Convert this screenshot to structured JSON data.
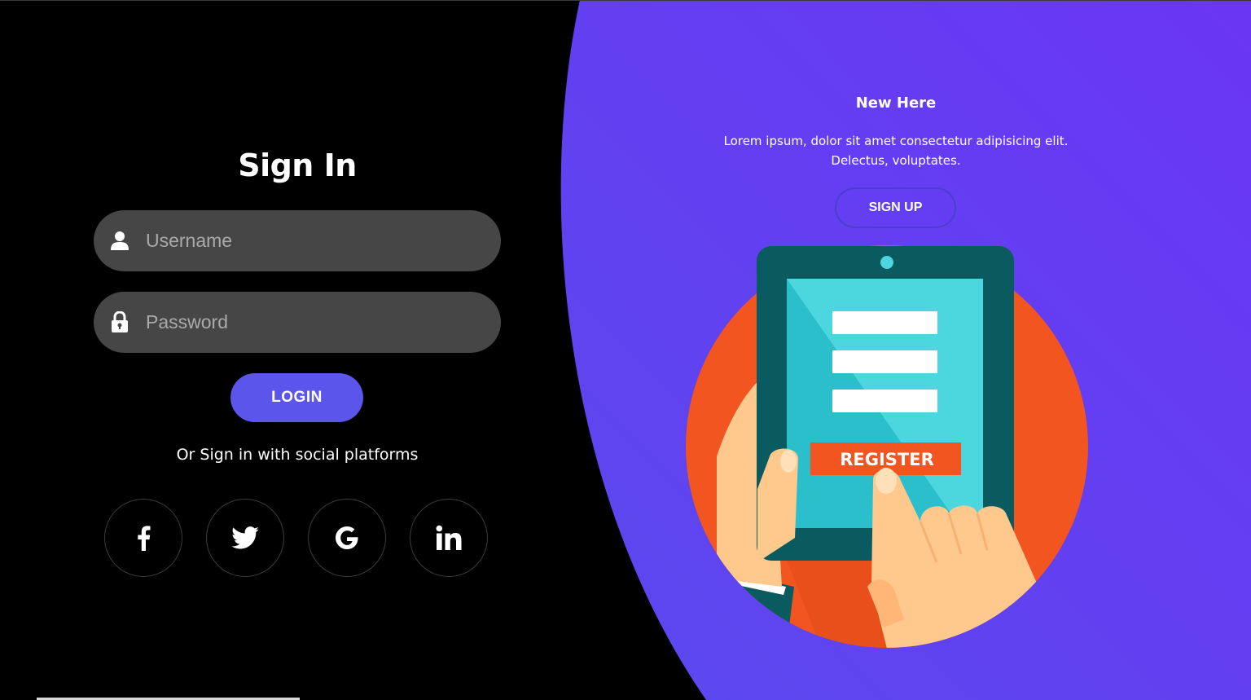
{
  "signin": {
    "title": "Sign In",
    "username_placeholder": "Username",
    "password_placeholder": "Password",
    "login_label": "LOGIN",
    "social_text": "Or Sign in with social platforms",
    "socials": [
      {
        "name": "facebook",
        "icon": "facebook-icon"
      },
      {
        "name": "twitter",
        "icon": "twitter-icon"
      },
      {
        "name": "google",
        "icon": "google-icon"
      },
      {
        "name": "linkedin",
        "icon": "linkedin-icon"
      }
    ]
  },
  "panel": {
    "title": "New Here",
    "text_line1": "Lorem ipsum, dolor sit amet consectetur adipisicing elit.",
    "text_line2": "Delectus, voluptates.",
    "signup_label": "SIGN UP",
    "illustration_button": "REGISTER"
  },
  "colors": {
    "background": "#000000",
    "panel_gradient_start": "#5b49ee",
    "panel_gradient_end": "#6a36f4",
    "input_background": "#464646",
    "login_button": "#5b55ec",
    "illustration_circle": "#f2551f",
    "tablet_frame": "#0a5b5f",
    "tablet_screen": "#4cd6de",
    "register_button": "#f2551f",
    "skin": "#ffc88c"
  }
}
